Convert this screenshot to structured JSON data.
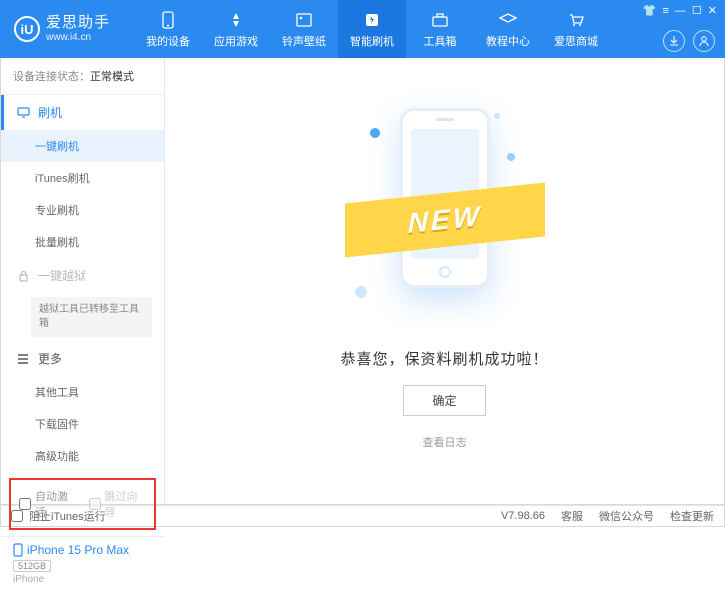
{
  "header": {
    "logo_letter": "iU",
    "title": "爱思助手",
    "url": "www.i4.cn",
    "nav": [
      {
        "label": "我的设备"
      },
      {
        "label": "应用游戏"
      },
      {
        "label": "铃声壁纸"
      },
      {
        "label": "智能刷机"
      },
      {
        "label": "工具箱"
      },
      {
        "label": "教程中心"
      },
      {
        "label": "爱思商城"
      }
    ]
  },
  "sidebar": {
    "status_label": "设备连接状态：",
    "status_value": "正常模式",
    "flash_header": "刷机",
    "items": {
      "one_key": "一键刷机",
      "itunes": "iTunes刷机",
      "pro": "专业刷机",
      "batch": "批量刷机"
    },
    "jailbreak_header": "一键越狱",
    "jailbreak_note": "越狱工具已转移至工具箱",
    "more_header": "更多",
    "more": {
      "other": "其他工具",
      "download": "下载固件",
      "advanced": "高级功能"
    },
    "auto_activate": "自动激活",
    "skip_guide": "跳过向导"
  },
  "device": {
    "name": "iPhone 15 Pro Max",
    "storage": "512GB",
    "type": "iPhone"
  },
  "main": {
    "ribbon": "NEW",
    "message": "恭喜您，保资料刷机成功啦！",
    "ok": "确定",
    "view_log": "查看日志"
  },
  "footer": {
    "block_itunes": "阻止iTunes运行",
    "version": "V7.98.66",
    "links": [
      "客服",
      "微信公众号",
      "检查更新"
    ]
  }
}
